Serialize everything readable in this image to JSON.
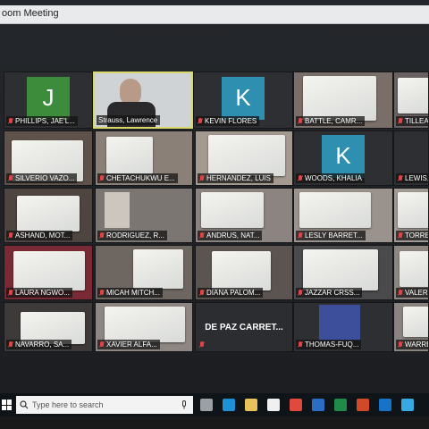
{
  "window": {
    "title": "oom Meeting"
  },
  "participants": [
    {
      "name": "PHILLIPS, JAE'L...",
      "initial": "J",
      "avatar_color": "#3d8c3c"
    },
    {
      "name": "Strauss, Lawrence"
    },
    {
      "name": "KEVIN FLORES",
      "initial": "K",
      "avatar_color": "#2f8fb1"
    },
    {
      "name": "BATTLE, CAMR...",
      "sign_text": "Thank You"
    },
    {
      "name": "TILLEAR"
    },
    {
      "name": "SILVERIO VAZO...",
      "sign_text": "THANK YOU Mr. Strauss!!"
    },
    {
      "name": "CHETACHUKWU E..."
    },
    {
      "name": "HERNANDEZ, LUIS"
    },
    {
      "name": "WOODS, KHALIA",
      "initial": "K",
      "avatar_color": "#2f8fb1"
    },
    {
      "name": "LEWIS, D"
    },
    {
      "name": "ASHAND, MOT..."
    },
    {
      "name": "RODRIGUEZ, R..."
    },
    {
      "name": "ANDRUS, NAT...",
      "sign_text": "Thank You"
    },
    {
      "name": "LESLY BARRET..."
    },
    {
      "name": "TORRES"
    },
    {
      "name": "LAURA NGWO..."
    },
    {
      "name": "MICAH MITCH...",
      "sign_text": "THANK U STRAUSS"
    },
    {
      "name": "DIANA PALOM..."
    },
    {
      "name": "JAZZAR CRSS...",
      "sign_text": "Thank You STRAUSS"
    },
    {
      "name": "VALERY G"
    },
    {
      "name": "NAVARRO, SA..."
    },
    {
      "name": "XAVIER ALFA..."
    },
    {
      "name": "DE PAZ CARRET..."
    },
    {
      "name": "THOMAS-FUQ..."
    },
    {
      "name": "WARREN, A"
    }
  ],
  "taskbar": {
    "search_placeholder": "Type here to search",
    "icons": [
      "task-view-icon",
      "edge-icon",
      "file-explorer-icon",
      "store-icon",
      "chrome-icon",
      "word-icon",
      "excel-icon",
      "powerpoint-icon",
      "outlook-icon",
      "edge-alt-icon"
    ],
    "icon_colors": [
      "#9aa0a6",
      "#1e90d6",
      "#e8c25a",
      "#f0f0f0",
      "#e04a3c",
      "#2b6cc4",
      "#1f8a4a",
      "#d04a2a",
      "#1673c8",
      "#38a8e0"
    ]
  }
}
